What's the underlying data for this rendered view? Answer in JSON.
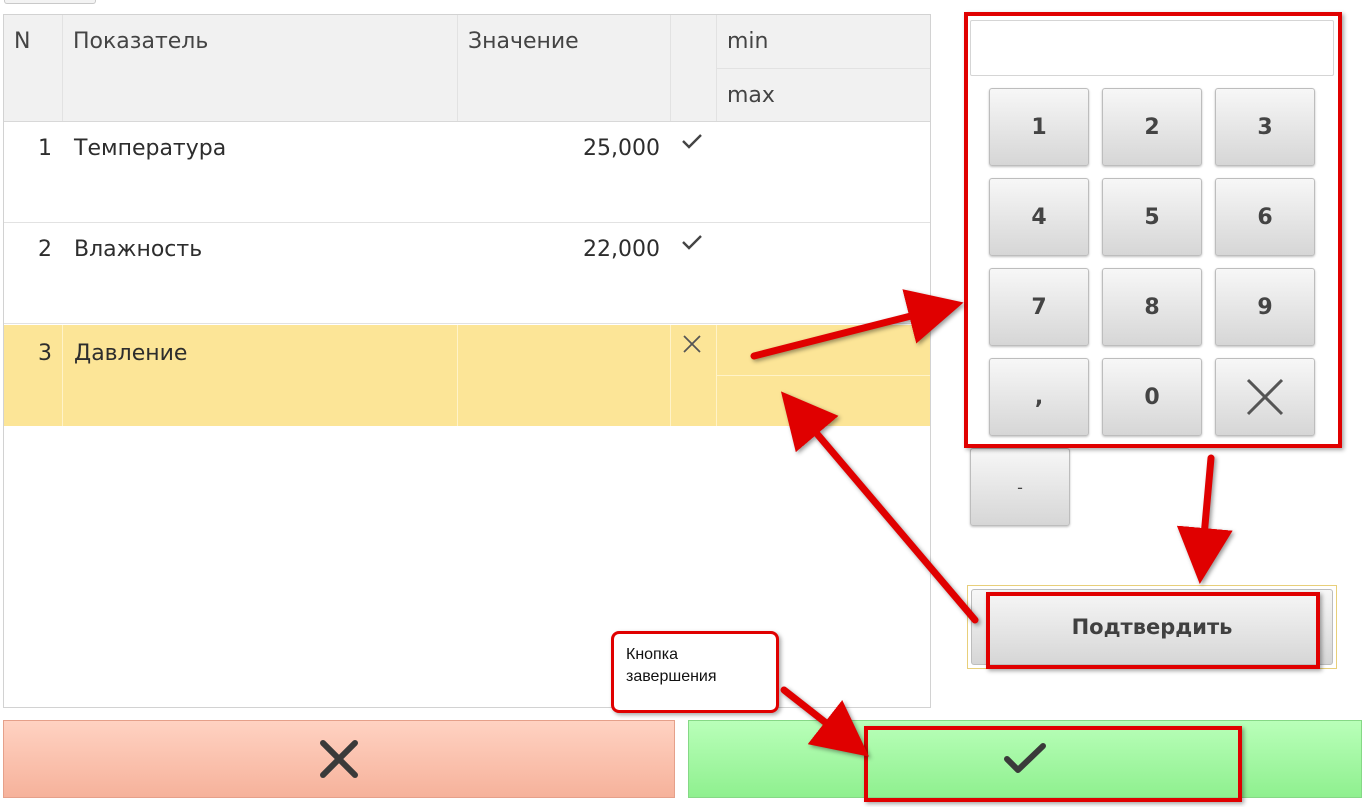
{
  "table": {
    "headers": {
      "n": "N",
      "indicator": "Показатель",
      "value": "Значение",
      "min": "min",
      "max": "max"
    },
    "rows": [
      {
        "n": "1",
        "name": "Температура",
        "value": "25,000",
        "status": "check",
        "selected": false
      },
      {
        "n": "2",
        "name": "Влажность",
        "value": "22,000",
        "status": "check",
        "selected": false
      },
      {
        "n": "3",
        "name": "Давление",
        "value": "",
        "status": "cross",
        "selected": true
      }
    ]
  },
  "keypad": {
    "display_value": "",
    "keys": [
      "1",
      "2",
      "3",
      "4",
      "5",
      "6",
      "7",
      "8",
      "9",
      ",",
      "0",
      "×"
    ],
    "minus_key": "-",
    "confirm_label": "Подтвердить"
  },
  "footer": {
    "cancel_icon": "close-icon",
    "finish_icon": "check-icon"
  },
  "annotation": {
    "callout_text_line1": "Кнопка",
    "callout_text_line2": "завершения"
  },
  "colors": {
    "selected_row": "#fce597",
    "cancel_bg": "#f6b29b",
    "finish_bg": "#8ff08f",
    "annotation_red": "#e00000"
  }
}
